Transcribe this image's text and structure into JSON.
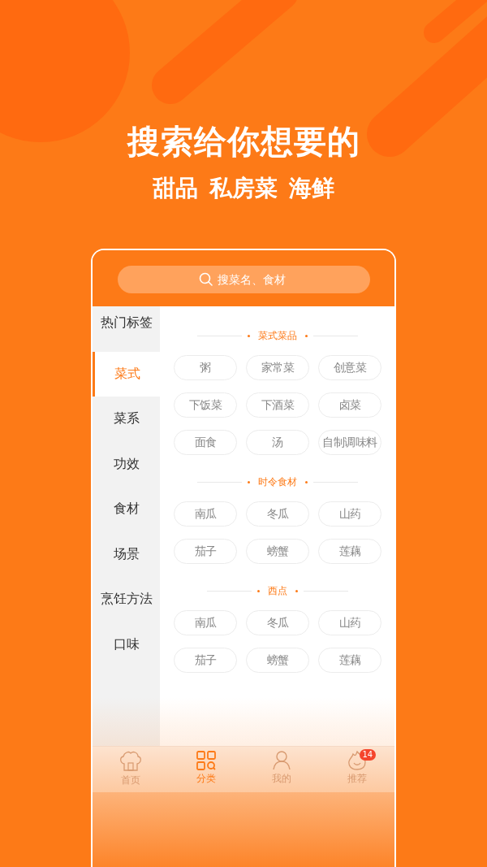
{
  "headline": "搜索给你想要的",
  "subtitle": "甜品 私房菜 海鲜",
  "search": {
    "placeholder": "搜菜名、食材"
  },
  "categories": [
    {
      "label": "热门标签",
      "selected": false
    },
    {
      "label": "菜式",
      "selected": true
    },
    {
      "label": "菜系",
      "selected": false
    },
    {
      "label": "功效",
      "selected": false
    },
    {
      "label": "食材",
      "selected": false
    },
    {
      "label": "场景",
      "selected": false
    },
    {
      "label": "烹饪方法",
      "selected": false
    },
    {
      "label": "口味",
      "selected": false
    }
  ],
  "sections": [
    {
      "title": "菜式菜品",
      "tags": [
        "粥",
        "家常菜",
        "创意菜",
        "下饭菜",
        "下酒菜",
        "卤菜",
        "面食",
        "汤",
        "自制调味料"
      ]
    },
    {
      "title": "时令食材",
      "tags": [
        "南瓜",
        "冬瓜",
        "山药",
        "茄子",
        "螃蟹",
        "莲藕"
      ]
    },
    {
      "title": "西点",
      "tags": [
        "南瓜",
        "冬瓜",
        "山药",
        "茄子",
        "螃蟹",
        "莲藕"
      ]
    }
  ],
  "nav": [
    {
      "kind": "home",
      "label": "首页",
      "selected": false
    },
    {
      "kind": "category",
      "label": "分类",
      "selected": true
    },
    {
      "kind": "profile",
      "label": "我的",
      "selected": false
    },
    {
      "kind": "recommend",
      "label": "推荐",
      "selected": false,
      "badge": "14"
    }
  ]
}
